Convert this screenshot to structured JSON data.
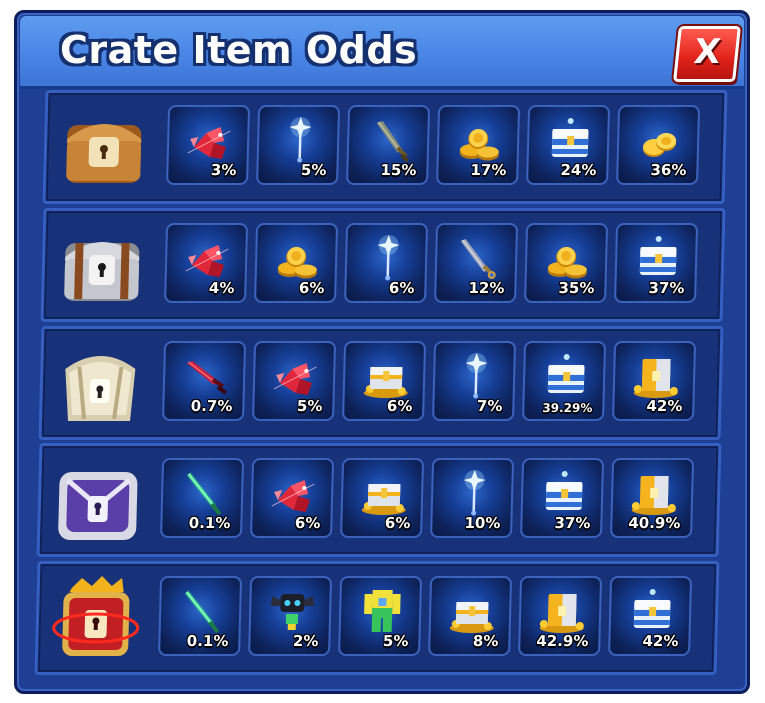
{
  "window": {
    "title": "Crate Item Odds",
    "close_label": "X"
  },
  "crates": [
    {
      "crate_icon": "wooden-crate-icon",
      "items": [
        {
          "icon": "red-shard-icon",
          "odds": "3%"
        },
        {
          "icon": "blue-wand-icon",
          "odds": "5%"
        },
        {
          "icon": "sword-icon",
          "odds": "15%"
        },
        {
          "icon": "gold-coin-pile-icon",
          "odds": "17%"
        },
        {
          "icon": "blue-chest-icon",
          "odds": "24%"
        },
        {
          "icon": "gold-coins-icon",
          "odds": "36%"
        }
      ]
    },
    {
      "crate_icon": "iron-crate-icon",
      "items": [
        {
          "icon": "red-shard-icon",
          "odds": "4%"
        },
        {
          "icon": "gold-coin-pile-icon",
          "odds": "6%"
        },
        {
          "icon": "blue-wand-icon",
          "odds": "6%"
        },
        {
          "icon": "jeweled-sword-icon",
          "odds": "12%"
        },
        {
          "icon": "gold-coin-pile-icon",
          "odds": "35%"
        },
        {
          "icon": "blue-chest-icon",
          "odds": "37%"
        }
      ]
    },
    {
      "crate_icon": "ivory-crate-icon",
      "items": [
        {
          "icon": "red-dagger-icon",
          "odds": "0.7%"
        },
        {
          "icon": "red-shard-icon",
          "odds": "5%"
        },
        {
          "icon": "silver-chest-coins-icon",
          "odds": "6%"
        },
        {
          "icon": "blue-wand-icon",
          "odds": "7%"
        },
        {
          "icon": "blue-chest-icon",
          "odds": "39.29%"
        },
        {
          "icon": "gold-chest-coins-icon",
          "odds": "42%"
        }
      ]
    },
    {
      "crate_icon": "purple-crate-icon",
      "items": [
        {
          "icon": "green-sword-icon",
          "odds": "0.1%"
        },
        {
          "icon": "red-shard-icon",
          "odds": "6%"
        },
        {
          "icon": "silver-chest-coins-icon",
          "odds": "6%"
        },
        {
          "icon": "blue-wand-icon",
          "odds": "10%"
        },
        {
          "icon": "blue-chest-icon",
          "odds": "37%"
        },
        {
          "icon": "gold-chest-coins-icon",
          "odds": "40.9%"
        }
      ]
    },
    {
      "crate_icon": "royal-red-crate-icon",
      "items": [
        {
          "icon": "green-sword-icon",
          "odds": "0.1%"
        },
        {
          "icon": "pet-robot-icon",
          "odds": "2%"
        },
        {
          "icon": "avatar-outfit-icon",
          "odds": "5%"
        },
        {
          "icon": "silver-chest-coins-icon",
          "odds": "8%"
        },
        {
          "icon": "gold-chest-coins-icon",
          "odds": "42.9%"
        },
        {
          "icon": "blue-chest-icon",
          "odds": "42%"
        }
      ]
    }
  ],
  "colors": {
    "panel_bg": "#1e3f93",
    "title_bar": "#4a86e6",
    "close_red": "#e0221a",
    "slot_glow": "#2d66c9"
  }
}
